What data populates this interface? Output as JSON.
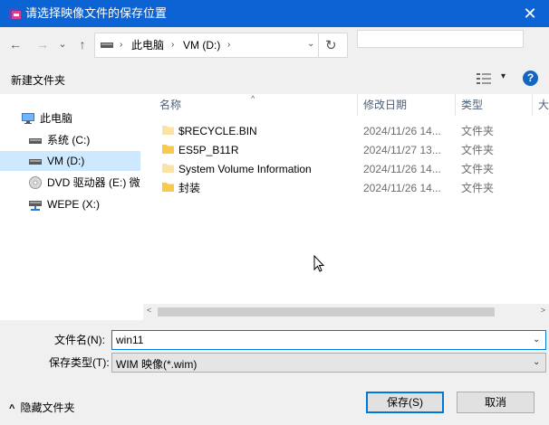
{
  "window": {
    "title": "请选择映像文件的保存位置",
    "close_glyph": "✕"
  },
  "nav": {
    "back_glyph": "←",
    "forward_glyph": "→",
    "dropdown_glyph": "⌄",
    "up_glyph": "↑",
    "address": {
      "sep_glyph": "›",
      "crumbs": [
        "此电脑",
        "VM (D:)"
      ],
      "dropdown_glyph": "⌄",
      "refresh_glyph": "↻"
    },
    "search_placeholder": ""
  },
  "toolbar": {
    "new_folder": "新建文件夹",
    "view_dropdown_glyph": "▾",
    "help_glyph": "?"
  },
  "sidebar": {
    "items": [
      {
        "label": "此电脑",
        "icon": "computer-icon"
      },
      {
        "label": "系统 (C:)",
        "icon": "drive-icon"
      },
      {
        "label": "VM (D:)",
        "icon": "drive-icon",
        "selected": true
      },
      {
        "label": "DVD 驱动器 (E:) 微",
        "icon": "dvd-icon"
      },
      {
        "label": "WEPE (X:)",
        "icon": "network-drive-icon"
      }
    ]
  },
  "filelist": {
    "columns": [
      "名称",
      "修改日期",
      "类型",
      "大"
    ],
    "sort_glyph": "^",
    "rows": [
      {
        "name": "$RECYCLE.BIN",
        "date": "2024/11/26 14...",
        "type": "文件夹",
        "faded": true
      },
      {
        "name": "ES5P_B11R",
        "date": "2024/11/27 13...",
        "type": "文件夹",
        "faded": false
      },
      {
        "name": "System Volume Information",
        "date": "2024/11/26 14...",
        "type": "文件夹",
        "faded": true
      },
      {
        "name": "封装",
        "date": "2024/11/26 14...",
        "type": "文件夹",
        "faded": false
      }
    ],
    "scroll_left_glyph": "<",
    "scroll_right_glyph": ">"
  },
  "bottom": {
    "filename_label": "文件名(N):",
    "filename_value": "win11",
    "type_label": "保存类型(T):",
    "type_value": "WIM 映像(*.wim)",
    "dropdown_glyph": "⌄",
    "hide_folders": "隐藏文件夹",
    "hide_folders_glyph": "^",
    "save": "保存(S)",
    "cancel": "取消"
  },
  "colors": {
    "titlebar": "#0c63d3",
    "accent": "#0078d7",
    "selected": "#cde8ff",
    "folder": "#f8c94d"
  }
}
